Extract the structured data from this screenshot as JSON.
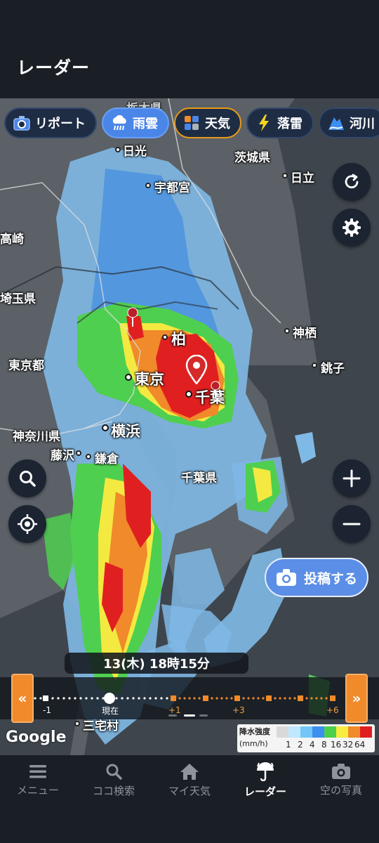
{
  "header": {
    "title": "レーダー"
  },
  "layers": [
    {
      "label": "リポート",
      "icon": "camera-icon"
    },
    {
      "label": "雨雲",
      "icon": "rain-cloud-icon",
      "active": true
    },
    {
      "label": "天気",
      "icon": "weather-grid-icon"
    },
    {
      "label": "落雷",
      "icon": "lightning-icon"
    },
    {
      "label": "河川",
      "icon": "river-icon"
    }
  ],
  "places": {
    "tochigi_pref": "栃木県",
    "nikko": "日光",
    "utsunomiya": "宇都宮",
    "ibaraki_pref": "茨城県",
    "hitachi": "日立",
    "takasaki": "高崎",
    "saitama_pref": "埼玉県",
    "kashiwa": "柏",
    "kamisu": "神栖",
    "tokyo_pref": "東京都",
    "tokyo": "東京",
    "chiba": "千葉",
    "choshi": "銚子",
    "kanagawa_pref": "神奈川県",
    "yokohama": "横浜",
    "fujisawa": "藤沢",
    "kamakura": "鎌倉",
    "chiba_pref": "千葉県",
    "miyake": "三宅村"
  },
  "post_button": {
    "label": "投稿する"
  },
  "timeline": {
    "current_time": "13(木) 18時15分",
    "labels": {
      "minus1": "-1",
      "now": "現在",
      "plus1": "+1",
      "plus3": "+3",
      "plus6": "+6"
    }
  },
  "google_logo": "Google",
  "legend": {
    "title1": "降水強度",
    "title2": "(mm/h)",
    "values": [
      "1",
      "2",
      "4",
      "8",
      "16",
      "32",
      "64"
    ],
    "colors": [
      "#d9d9d9",
      "#bfe7ff",
      "#73c6f7",
      "#3c8ff0",
      "#4cd04c",
      "#f7ec3f",
      "#f08a2a",
      "#e02020"
    ]
  },
  "nav": [
    {
      "label": "メニュー",
      "icon": "menu-icon"
    },
    {
      "label": "ココ検索",
      "icon": "search-icon"
    },
    {
      "label": "マイ天気",
      "icon": "home-icon"
    },
    {
      "label": "レーダー",
      "icon": "radar-umbrella-icon",
      "active": true
    },
    {
      "label": "空の写真",
      "icon": "camera-icon"
    }
  ],
  "colors": {
    "background": "#1a1f26",
    "accent": "#4a86e8",
    "timeline_orange": "#f08a2a"
  }
}
